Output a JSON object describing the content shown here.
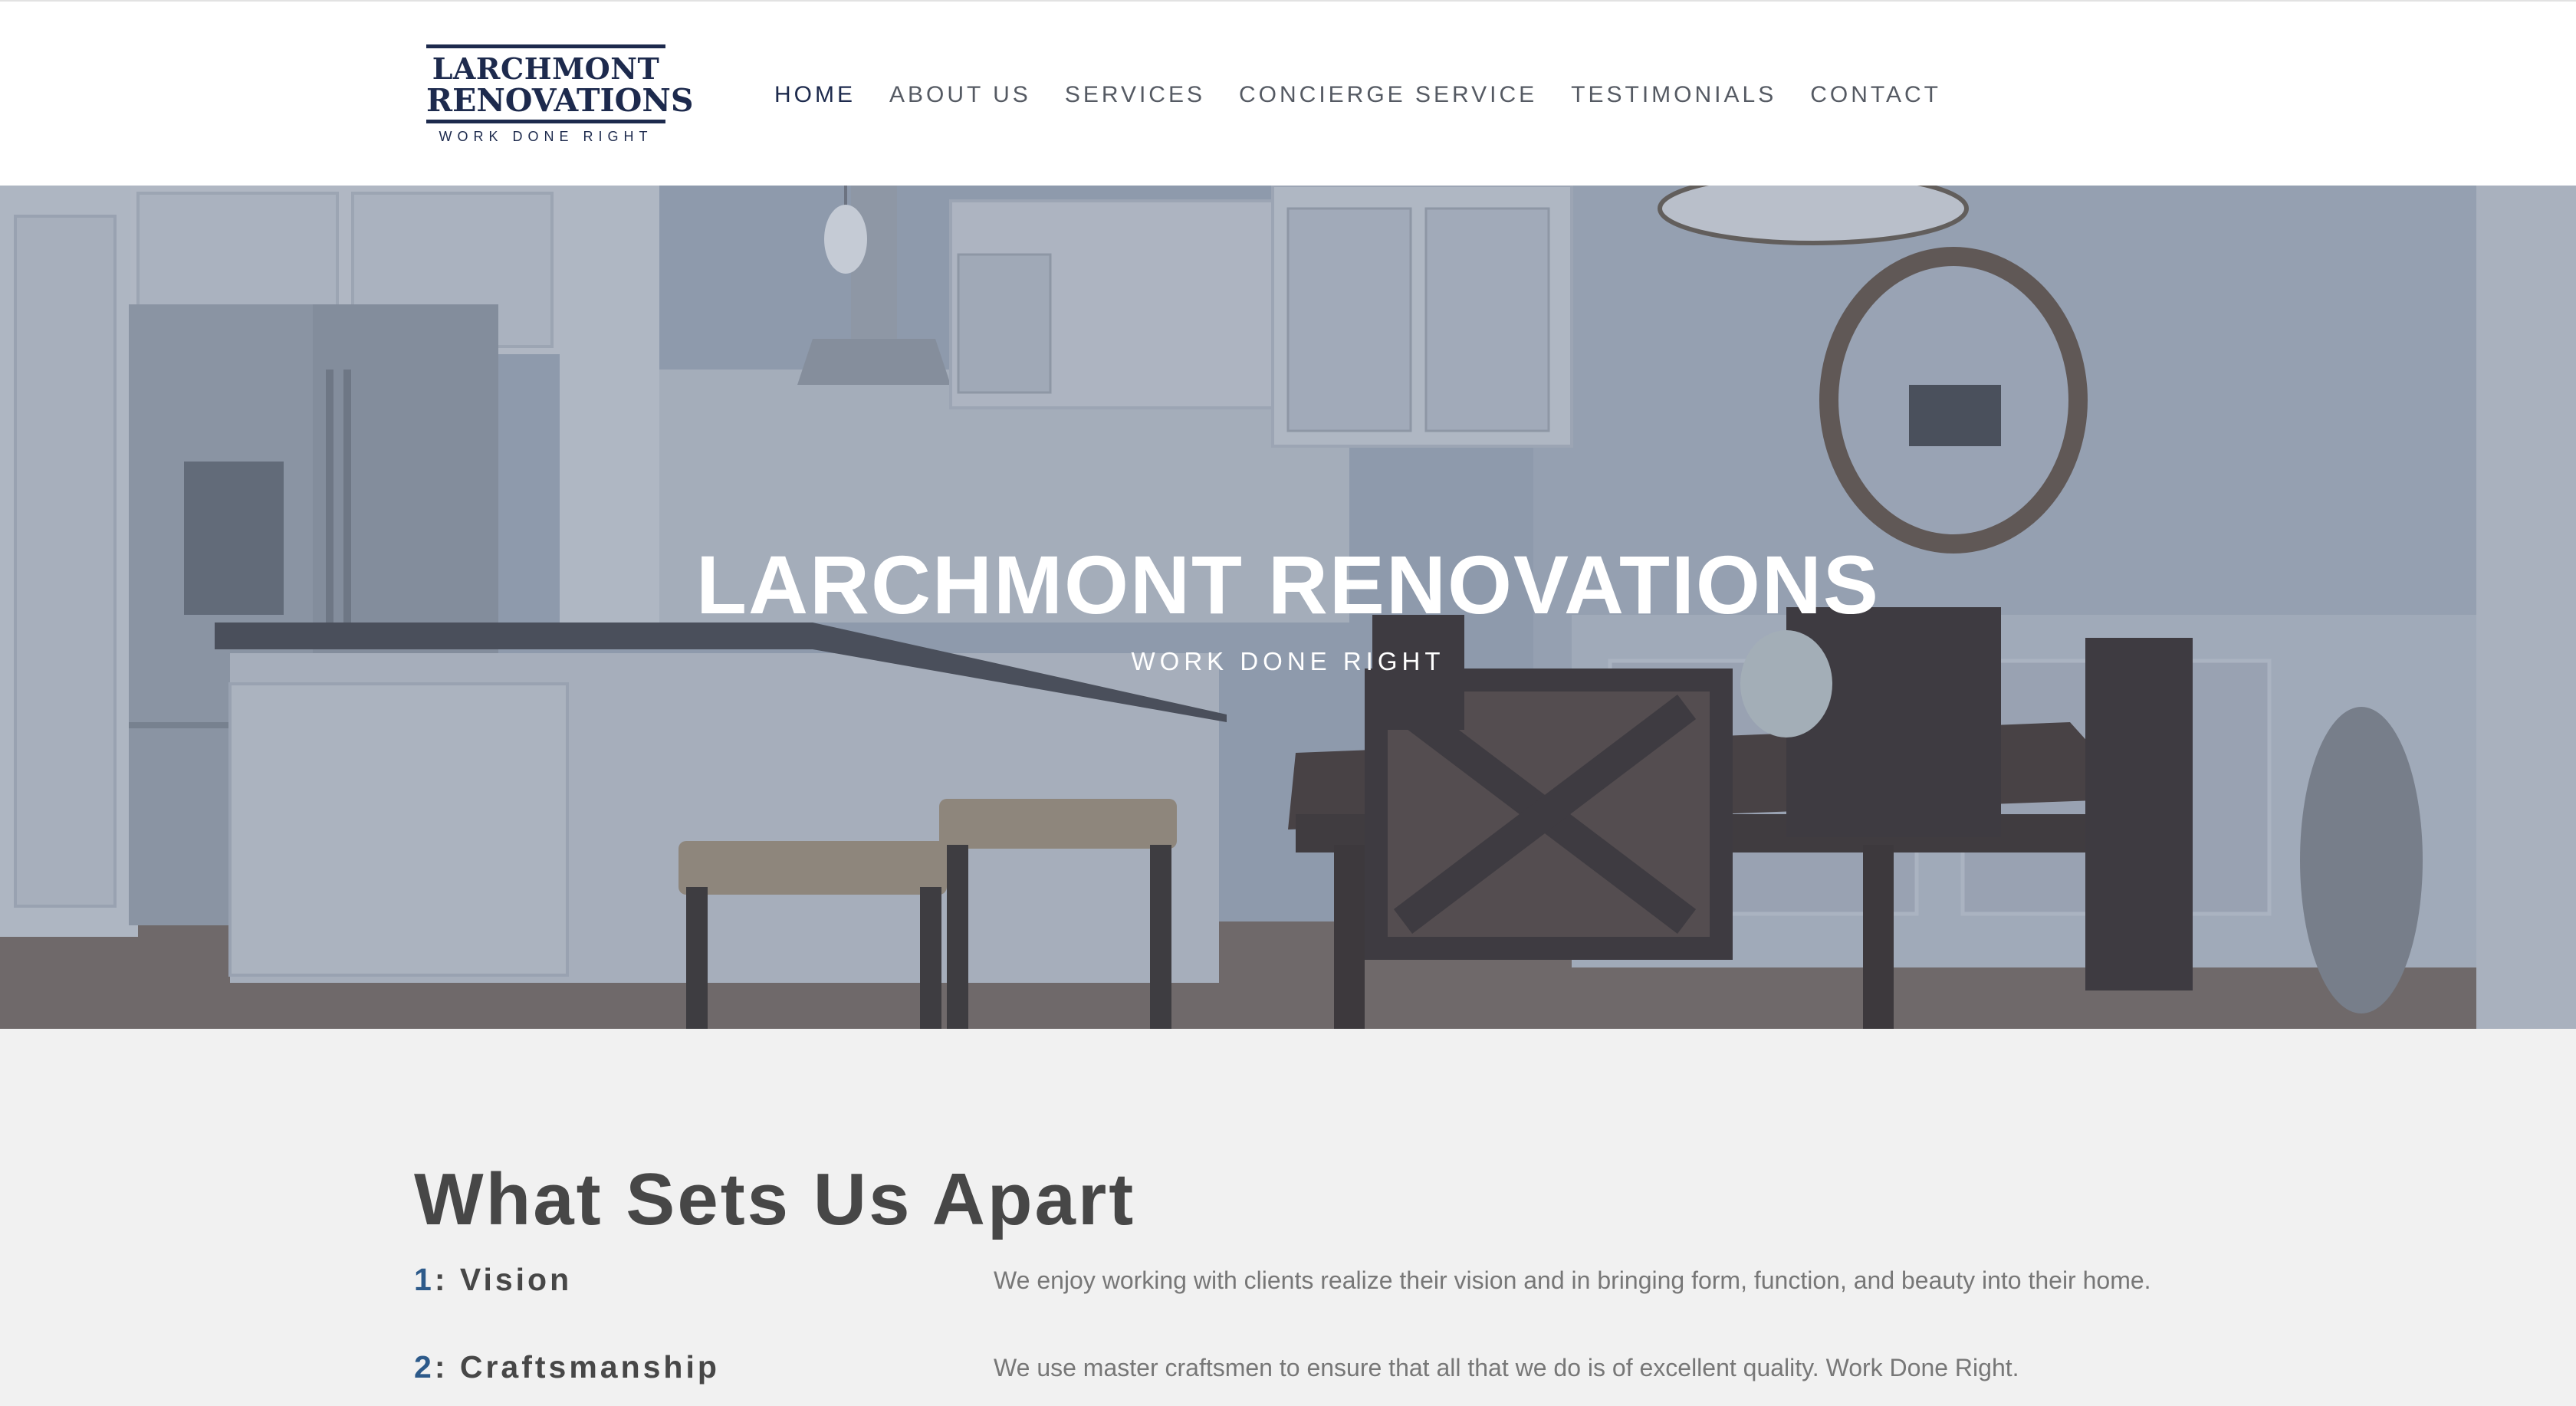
{
  "header": {
    "logo": {
      "line1": "LARCHMONT",
      "line2": "RENOVATIONS",
      "tagline": "WORK DONE RIGHT"
    },
    "nav": [
      {
        "label": "HOME",
        "active": true
      },
      {
        "label": "ABOUT US",
        "active": false
      },
      {
        "label": "SERVICES",
        "active": false
      },
      {
        "label": "CONCIERGE SERVICE",
        "active": false
      },
      {
        "label": "TESTIMONIALS",
        "active": false
      },
      {
        "label": "CONTACT",
        "active": false
      }
    ]
  },
  "hero": {
    "title": "LARCHMONT RENOVATIONS",
    "subtitle": "WORK DONE RIGHT"
  },
  "features": {
    "title": "What Sets Us Apart",
    "items": [
      {
        "number": "1",
        "label": ": Vision",
        "description": "We enjoy working with clients realize their vision and in bringing form, function, and beauty into their home."
      },
      {
        "number": "2",
        "label": ": Craftsmanship",
        "description": "We use master craftsmen to ensure that all that we do is of excellent quality.  Work Done Right."
      }
    ]
  },
  "colors": {
    "brand_navy": "#1d2a4d",
    "number_blue": "#2d5a8a",
    "heading_gray": "#474747",
    "body_gray": "#777777",
    "content_bg": "#f1f1f1"
  }
}
